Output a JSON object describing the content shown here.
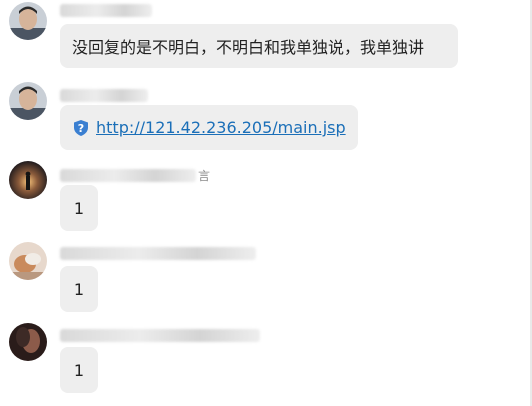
{
  "messages": [
    {
      "sender_suffix": "",
      "text": "没回复的是不明白，不明白和我单独说，我单独讲",
      "type": "text"
    },
    {
      "sender_suffix": "",
      "link": "http://121.42.236.205/main.jsp",
      "icon": "shield-question-icon",
      "type": "link"
    },
    {
      "sender_suffix": "言",
      "text": "1",
      "type": "text"
    },
    {
      "sender_suffix": "",
      "text": "1",
      "type": "text"
    },
    {
      "sender_suffix": "",
      "text": "1",
      "type": "text"
    }
  ],
  "colors": {
    "bubble": "#eeeeee",
    "link": "#1b6fb8",
    "shield": "#3a7fd1"
  }
}
